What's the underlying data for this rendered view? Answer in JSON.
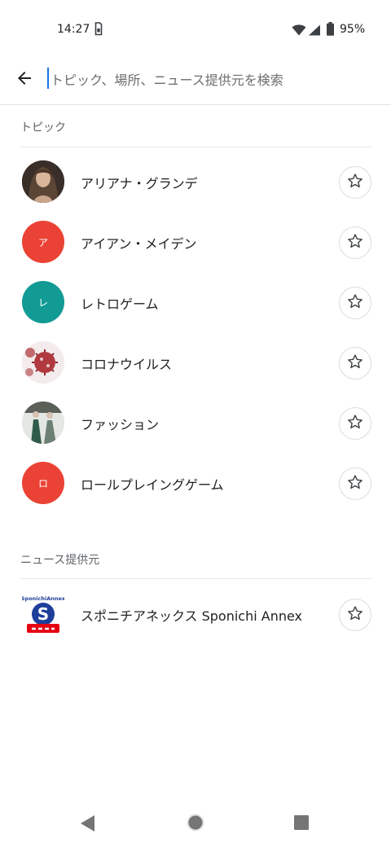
{
  "status_bar": {
    "time": "14:27",
    "battery": "95%",
    "icons": [
      "sim-card-icon",
      "wifi-icon",
      "signal-icon",
      "battery-icon"
    ]
  },
  "search": {
    "placeholder": "トピック、場所、ニュース提供元を検索",
    "value": ""
  },
  "topics": {
    "header": "トピック",
    "items": [
      {
        "label": "アリアナ・グランデ",
        "avatar_type": "photo-portrait",
        "avatar_text": ""
      },
      {
        "label": "アイアン・メイデン",
        "avatar_type": "letter",
        "avatar_text": "ア",
        "avatar_color": "#ea4335"
      },
      {
        "label": "レトロゲーム",
        "avatar_type": "letter",
        "avatar_text": "レ",
        "avatar_color": "#129a94"
      },
      {
        "label": "コロナウイルス",
        "avatar_type": "photo-virus",
        "avatar_text": ""
      },
      {
        "label": "ファッション",
        "avatar_type": "photo-fashion",
        "avatar_text": ""
      },
      {
        "label": "ロールプレイングゲーム",
        "avatar_type": "letter",
        "avatar_text": "ロ",
        "avatar_color": "#ea4335"
      }
    ]
  },
  "sources": {
    "header": "ニュース提供元",
    "items": [
      {
        "label": "スポニチアネックス Sponichi Annex",
        "avatar_type": "logo-sponichi",
        "logo_text": "SponichiAnnex"
      }
    ]
  },
  "colors": {
    "accent": "#1a73e8",
    "red_avatar": "#ea4335",
    "teal_avatar": "#129a94",
    "logo_blue": "#1d3f9a",
    "logo_red": "#e60012"
  }
}
